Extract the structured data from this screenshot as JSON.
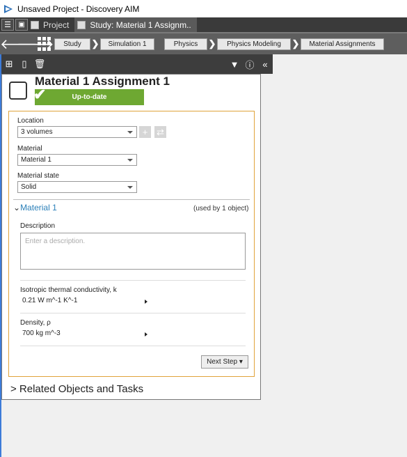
{
  "window": {
    "title": "Unsaved Project - Discovery AIM"
  },
  "tabs": [
    {
      "label": "Project"
    },
    {
      "label": "Study: Material 1 Assignm.."
    }
  ],
  "breadcrumb": [
    "Study",
    "Simulation 1",
    "Physics",
    "Physics Modeling",
    "Material Assignments"
  ],
  "object": {
    "title": "Material 1 Assignment 1",
    "status": "Up-to-date"
  },
  "form": {
    "location_label": "Location",
    "location_value": "3 volumes",
    "material_label": "Material",
    "material_value": "Material 1",
    "material_state_label": "Material state",
    "material_state_value": "Solid"
  },
  "material_section": {
    "title": "Material 1",
    "used_by": "(used by 1 object)",
    "description_label": "Description",
    "description_placeholder": "Enter a description.",
    "conductivity_label": "Isotropic thermal conductivity, k",
    "conductivity_value": "0.21 W m^-1 K^-1",
    "density_label": "Density, ρ",
    "density_value": "700 kg m^-3"
  },
  "next_step_label": "Next Step ▾",
  "related": "> Related Objects and Tasks",
  "accent_color": "#e0a33a",
  "status_color": "#6ea832"
}
